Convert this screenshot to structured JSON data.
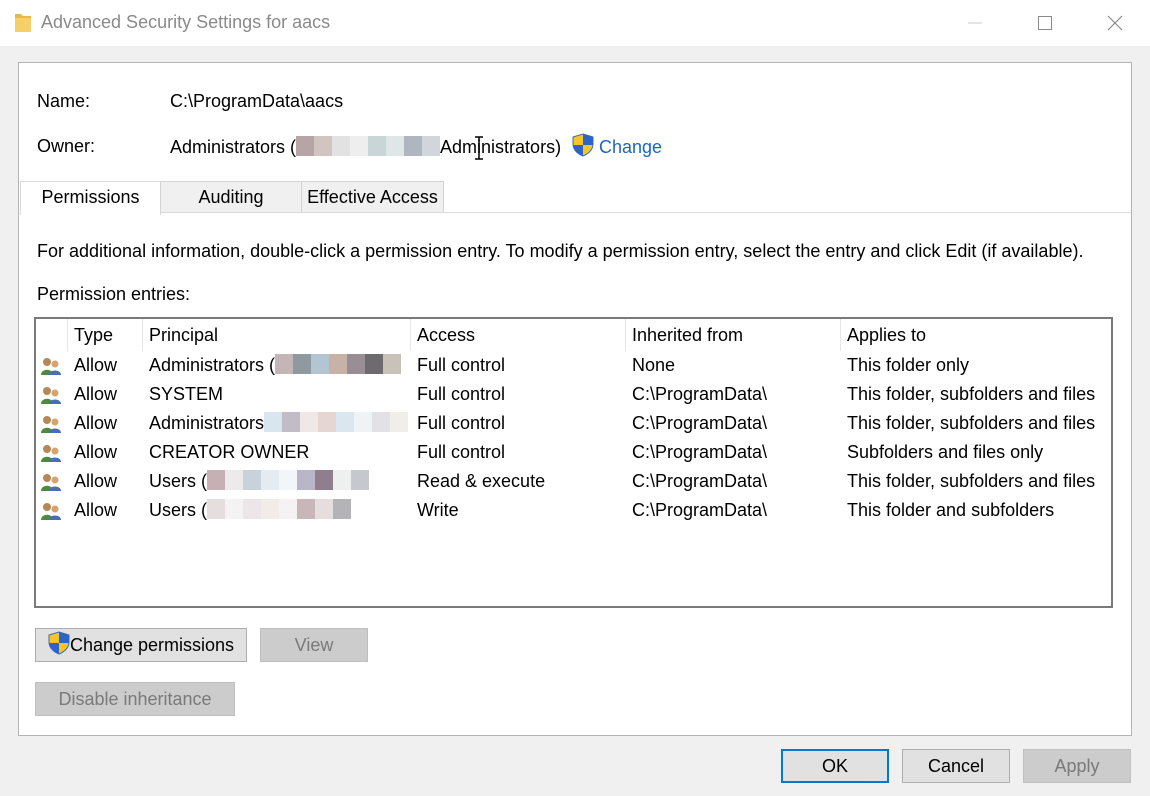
{
  "window": {
    "title": "Advanced Security Settings for aacs",
    "icon": "folder-icon",
    "controls": [
      "minimize-icon",
      "maximize-icon",
      "close-icon"
    ]
  },
  "info": {
    "name_label": "Name:",
    "name_value": "C:\\ProgramData\\aacs",
    "owner_label": "Owner:",
    "owner_value_start": "Administrators (",
    "owner_value_end": "Administrators)",
    "change_link": "Change"
  },
  "tabs": [
    {
      "label": "Permissions",
      "active": true
    },
    {
      "label": "Auditing",
      "active": false
    },
    {
      "label": "Effective Access",
      "active": false
    }
  ],
  "instructions": "For additional information, double-click a permission entry. To modify a permission entry, select the entry and click Edit (if available).",
  "entries_label": "Permission entries:",
  "table": {
    "columns": [
      "Type",
      "Principal",
      "Access",
      "Inherited from",
      "Applies to"
    ],
    "rows": [
      {
        "type": "Allow",
        "principal": "Administrators (",
        "access": "Full control",
        "inherited": "None",
        "applies": "This folder only"
      },
      {
        "type": "Allow",
        "principal": "SYSTEM",
        "access": "Full control",
        "inherited": "C:\\ProgramData\\",
        "applies": "This folder, subfolders and files"
      },
      {
        "type": "Allow",
        "principal": "Administrators",
        "access": "Full control",
        "inherited": "C:\\ProgramData\\",
        "applies": "This folder, subfolders and files"
      },
      {
        "type": "Allow",
        "principal": "CREATOR OWNER",
        "access": "Full control",
        "inherited": "C:\\ProgramData\\",
        "applies": "Subfolders and files only"
      },
      {
        "type": "Allow",
        "principal": "Users (",
        "access": "Read & execute",
        "inherited": "C:\\ProgramData\\",
        "applies": "This folder, subfolders and files"
      },
      {
        "type": "Allow",
        "principal": "Users (",
        "access": "Write",
        "inherited": "C:\\ProgramData\\",
        "applies": "This folder and subfolders"
      }
    ]
  },
  "buttons": {
    "change_permissions": "Change permissions",
    "view": "View",
    "disable_inheritance": "Disable inheritance",
    "ok": "OK",
    "cancel": "Cancel",
    "apply": "Apply"
  },
  "colors": {
    "link": "#1a67c4",
    "default_button_border": "#0078d7",
    "disabled_button": "#cccccc"
  }
}
